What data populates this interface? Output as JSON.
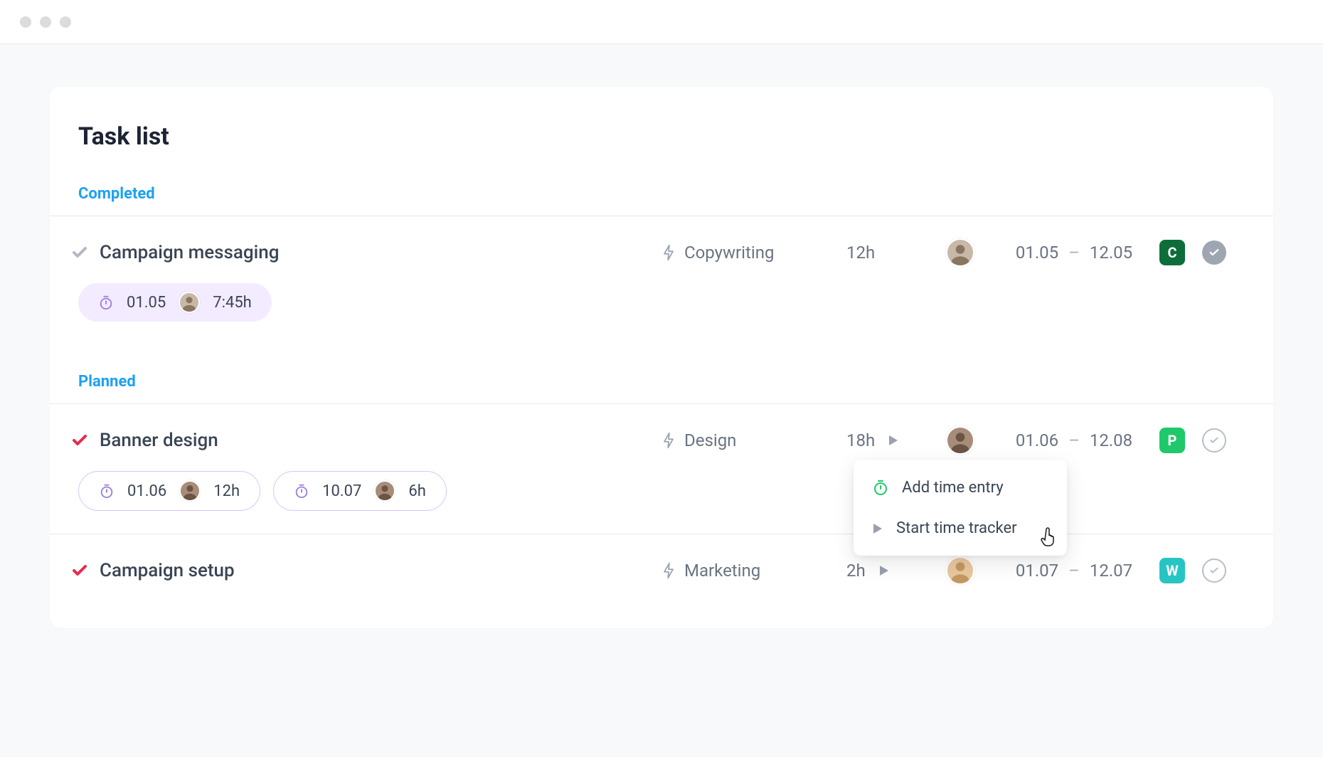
{
  "title": "Task list",
  "sections": {
    "completed": {
      "label": "Completed"
    },
    "planned": {
      "label": "Planned"
    }
  },
  "tasks": {
    "completed": [
      {
        "name": "Campaign messaging",
        "category": "Copywriting",
        "hours": "12h",
        "date_start": "01.05",
        "date_end": "12.05",
        "status_letter": "C",
        "done": true,
        "avatar_color": "#c8b8a7",
        "time_entries": [
          {
            "date": "01.05",
            "duration": "7:45h",
            "avatar_color": "#c8b8a7"
          }
        ]
      }
    ],
    "planned": [
      {
        "name": "Banner design",
        "category": "Design",
        "hours": "18h",
        "date_start": "01.06",
        "date_end": "12.08",
        "status_letter": "P",
        "done": false,
        "avatar_color": "#a88c7a",
        "show_play": true,
        "show_popover": true,
        "time_entries": [
          {
            "date": "01.06",
            "duration": "12h",
            "avatar_color": "#a88c7a"
          },
          {
            "date": "10.07",
            "duration": "6h",
            "avatar_color": "#a88c7a"
          }
        ]
      },
      {
        "name": "Campaign setup",
        "category": "Marketing",
        "hours": "2h",
        "date_start": "01.07",
        "date_end": "12.07",
        "status_letter": "W",
        "done": false,
        "avatar_color": "#e8c8a0",
        "show_play": true,
        "time_entries": []
      }
    ]
  },
  "popover": {
    "add_time": "Add time entry",
    "start_tracker": "Start time tracker"
  },
  "icons": {
    "stopwatch": "stopwatch-icon",
    "lightning": "lightning-icon",
    "play": "play-icon",
    "check": "check-icon"
  }
}
